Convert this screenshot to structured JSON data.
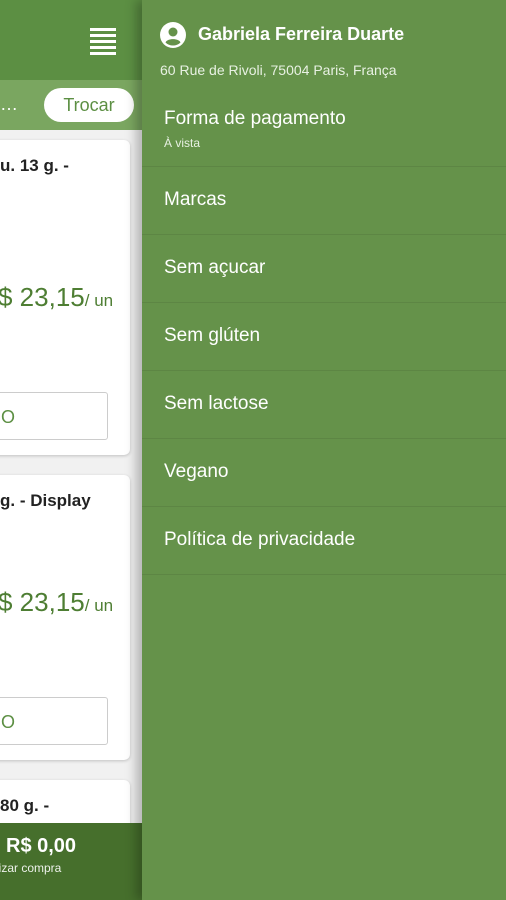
{
  "app": {
    "sub_bar_text": "…",
    "trocar_label": "Trocar",
    "cards": [
      {
        "title": "u. 13 g. -",
        "price": "$ 23,15",
        "unit": "/ un",
        "button": "O"
      },
      {
        "title": "g. - Display",
        "price": "$ 23,15",
        "unit": "/ un",
        "button": "O"
      },
      {
        "title": "80 g. -"
      }
    ],
    "cart": {
      "total": "R$ 0,00",
      "subtitle": "lizar compra"
    }
  },
  "drawer": {
    "user_name": "Gabriela Ferreira Duarte",
    "address": "60 Rue de Rivoli, 75004 Paris, França",
    "items": [
      {
        "label": "Forma de pagamento",
        "sublabel": "À vista"
      },
      {
        "label": "Marcas"
      },
      {
        "label": "Sem açucar"
      },
      {
        "label": "Sem glúten"
      },
      {
        "label": "Sem lactose"
      },
      {
        "label": "Vegano"
      },
      {
        "label": "Política de privacidade"
      }
    ]
  },
  "colors": {
    "primary": "#65924a",
    "dark": "#466f2c",
    "price": "#4e7e33"
  }
}
